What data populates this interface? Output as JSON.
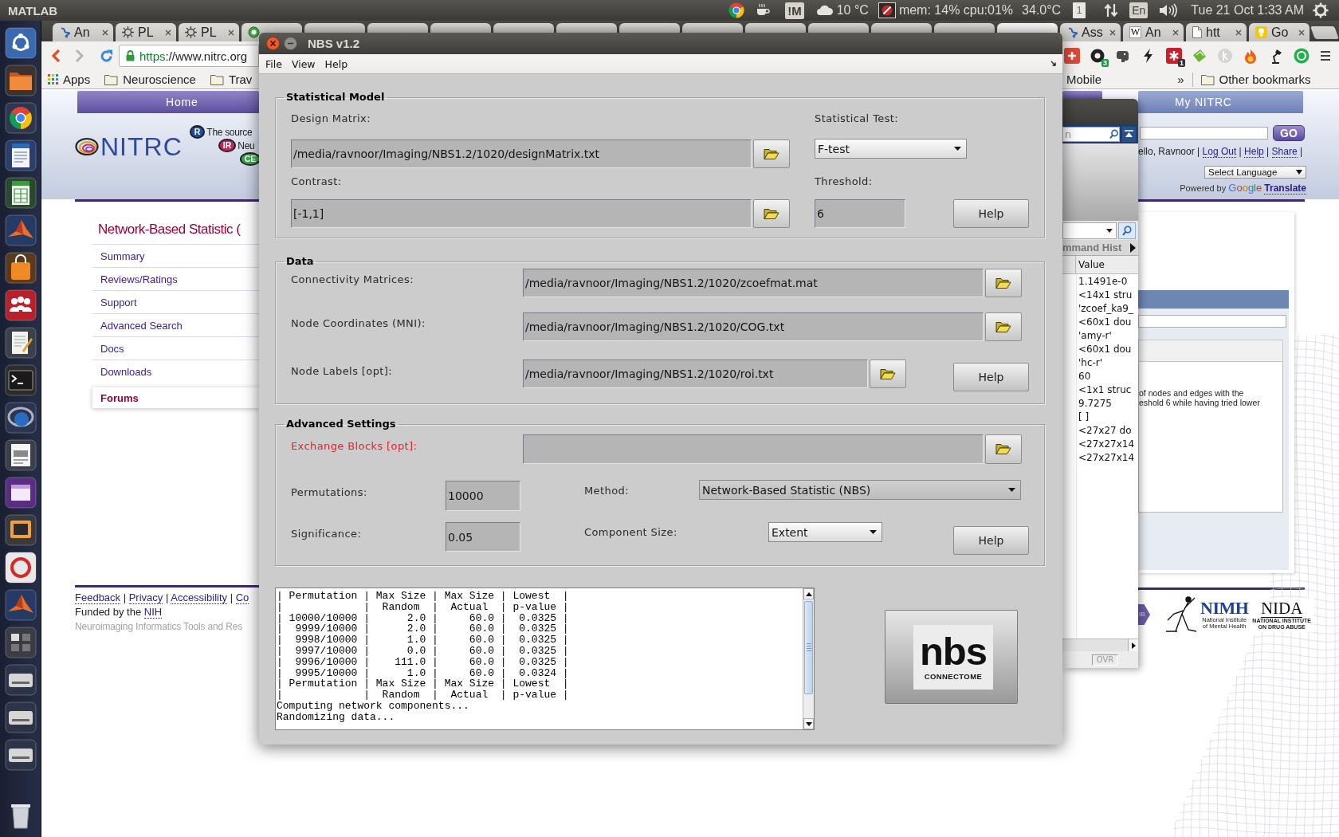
{
  "top_panel": {
    "app_name": "MATLAB",
    "indicator_label": "!M",
    "weather": "10 °C",
    "system_monitor": "mem: 14% cpu:01%",
    "temperature": "34.0°C",
    "notification_count": "1",
    "keyboard_layout": "En",
    "clock": "Tue 21 Oct 1:33 AM"
  },
  "browser": {
    "tabs": [
      {
        "kind": "scholar",
        "title": "An",
        "selected": false
      },
      {
        "kind": "atom",
        "title": "PL",
        "selected": false
      },
      {
        "kind": "atom",
        "title": "PL",
        "selected": false
      },
      {
        "kind": "ring",
        "selected": false
      },
      {
        "kind": "peek",
        "selected": false
      },
      {
        "kind": "peek",
        "selected": false
      },
      {
        "kind": "peek",
        "selected": false
      },
      {
        "kind": "peek",
        "selected": false
      },
      {
        "kind": "peek",
        "selected": false
      },
      {
        "kind": "peek",
        "selected": false
      },
      {
        "kind": "peek",
        "selected": false
      },
      {
        "kind": "peek",
        "selected": false
      },
      {
        "kind": "peek",
        "selected": false
      },
      {
        "kind": "peek",
        "selected": false
      },
      {
        "kind": "peek",
        "selected": false
      },
      {
        "kind": "peek",
        "selected": true
      },
      {
        "kind": "scholar",
        "title": "Ass",
        "selected": false
      },
      {
        "kind": "lettered",
        "badge": "W",
        "title": "An",
        "selected": false
      },
      {
        "kind": "page",
        "title": "htt",
        "selected": false
      },
      {
        "kind": "bulb",
        "title": "Go",
        "selected": false
      }
    ],
    "address": {
      "scheme": "https",
      "rest": "://www.nitrc.org"
    },
    "extension_badges": [
      "3",
      "1"
    ],
    "bookmarks": [
      {
        "kind": "apps",
        "label": "Apps"
      },
      {
        "kind": "folder",
        "label": "Neuroscience"
      },
      {
        "kind": "folder",
        "label": "Trav"
      }
    ],
    "bookmarks_right": [
      {
        "kind": "plain",
        "label": "Mobile"
      },
      {
        "kind": "overflow",
        "label": "»"
      },
      {
        "kind": "folder",
        "label": "Other bookmarks"
      }
    ]
  },
  "page": {
    "nav_tabs": [
      "Home",
      "My NITRC"
    ],
    "logo": "NITRC",
    "partners": [
      {
        "badge": "R",
        "caption": "The source"
      },
      {
        "badge": "IR",
        "caption": "Neu"
      },
      {
        "badge": "CE"
      }
    ],
    "project_title": "Network-Based Statistic (",
    "project_menu": [
      {
        "label": "Summary",
        "selected": false
      },
      {
        "label": "Reviews/Ratings",
        "selected": false
      },
      {
        "label": "Support",
        "selected": false
      },
      {
        "label": "Advanced Search",
        "selected": false
      },
      {
        "label": "Docs",
        "selected": false
      },
      {
        "label": "Downloads",
        "selected": false
      },
      {
        "label": "Forums",
        "selected": true
      }
    ],
    "footer": {
      "links": [
        "Feedback",
        "Privacy",
        "Accessibility",
        "Co"
      ],
      "separator": "|",
      "funded_by": "Funded by the",
      "funder": "NIH",
      "tagline": "Neuroimaging Informatics Tools and Res"
    },
    "account": {
      "greeting": "ello, Ravnoor",
      "links": [
        "Log Out",
        "Help",
        "Share"
      ],
      "separator": "|"
    },
    "search_button": "GO",
    "language_select": "Select Language",
    "translate_credit": {
      "prefix": "Powered by",
      "brand": "Google",
      "product": "Translate"
    },
    "forum_excerpt": [
      "of nodes and edges with the",
      "eshold 6 while having tried lower"
    ],
    "sponsors": {
      "nibib": "IB",
      "nimh": "NIMH",
      "nimh_caption": [
        "National Institute",
        "of Mental Health"
      ],
      "nida": "NIDA",
      "nida_caption": [
        "NATIONAL INSTITUTE",
        "ON DRUG ABUSE"
      ]
    }
  },
  "matlab": {
    "search_placeholder": "n",
    "panel_title": "mmand Hist",
    "column": "Value",
    "values": [
      "1.1491e-0",
      "<14x1 stru",
      "'zcoef_ka9_",
      "<60x1 dou",
      "'amy-r'",
      "<60x1 dou",
      "'hc-r'",
      "60",
      "<1x1 struc",
      "9.7275",
      "[ ]",
      "<27x27 do",
      "<27x27x14",
      "<27x27x14"
    ],
    "status": "OVR"
  },
  "nbs": {
    "title": "NBS v1.2",
    "menu": [
      "File",
      "View",
      "Help"
    ],
    "statistical_model": {
      "title": "Statistical Model",
      "design_matrix": {
        "label": "Design Matrix:",
        "value": "/media/ravnoor/Imaging/NBS1.2/1020/designMatrix.txt"
      },
      "statistical_test": {
        "label": "Statistical Test:",
        "value": "F-test"
      },
      "contrast": {
        "label": "Contrast:",
        "value": "[-1,1]"
      },
      "threshold": {
        "label": "Threshold:",
        "value": "6"
      },
      "help": "Help"
    },
    "data": {
      "title": "Data",
      "inputs": [
        {
          "label": "Connectivity Matrices:",
          "value": "/media/ravnoor/Imaging/NBS1.2/1020/zcoefmat.mat"
        },
        {
          "label": "Node Coordinates (MNI):",
          "value": "/media/ravnoor/Imaging/NBS1.2/1020/COG.txt"
        },
        {
          "label": "Node Labels [opt]:",
          "value": "/media/ravnoor/Imaging/NBS1.2/1020/roi.txt"
        }
      ],
      "help": "Help"
    },
    "advanced_settings": {
      "title": "Advanced Settings",
      "exchange_blocks": {
        "label": "Exchange Blocks [opt]:",
        "highlighted": true
      },
      "permutations": {
        "label": "Permutations:",
        "value": "10000"
      },
      "method": {
        "label": "Method:",
        "value": "Network-Based Statistic (NBS)"
      },
      "significance": {
        "label": "Significance:",
        "value": "0.05"
      },
      "component_size": {
        "label": "Component Size:",
        "value": "Extent"
      },
      "help": "Help"
    },
    "console": [
      "| Permutation | Max Size | Max Size | Lowest  |",
      "|             |  Random  |  Actual  | p-value |",
      "| 10000/10000 |      2.0 |     60.0 |  0.0325 |",
      "|  9999/10000 |      2.0 |     60.0 |  0.0325 |",
      "|  9998/10000 |      1.0 |     60.0 |  0.0325 |",
      "|  9997/10000 |      0.0 |     60.0 |  0.0325 |",
      "|  9996/10000 |    111.0 |     60.0 |  0.0325 |",
      "|  9995/10000 |      1.0 |     60.0 |  0.0324 |",
      "| Permutation | Max Size | Max Size | Lowest  |",
      "|             |  Random  |  Actual  | p-value |",
      "Computing network components...",
      "Randomizing data..."
    ],
    "logo": {
      "word": "nbs",
      "caption": "CONNECTOME"
    }
  }
}
